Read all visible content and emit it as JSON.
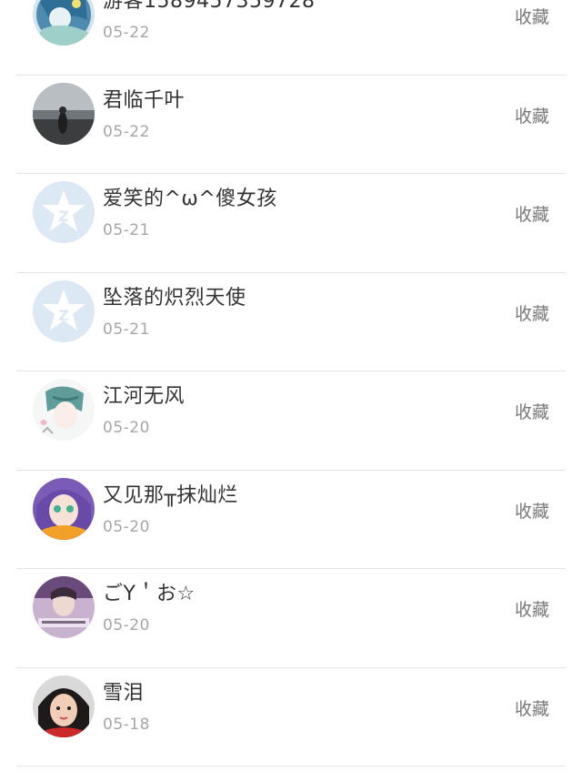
{
  "favorite_label": "收藏",
  "rows": [
    {
      "name": "游客1589457359728",
      "date": "05-22",
      "avatar": "anime-blue-avatar"
    },
    {
      "name": "君临千叶",
      "date": "05-22",
      "avatar": "photo-beach-avatar"
    },
    {
      "name": "爱笑的^ω^傻女孩",
      "date": "05-21",
      "avatar": "qzone-star-default-avatar"
    },
    {
      "name": "坠落的炽烈天使",
      "date": "05-21",
      "avatar": "qzone-star-default-avatar"
    },
    {
      "name": "江河无风",
      "date": "05-20",
      "avatar": "anime-sketch-avatar"
    },
    {
      "name": "又见那╥抹灿烂",
      "date": "05-20",
      "avatar": "anime-girl-avatar"
    },
    {
      "name": "ごY＇お☆",
      "date": "05-20",
      "avatar": "photo-girl-text-avatar"
    },
    {
      "name": "雪泪",
      "date": "05-18",
      "avatar": "photo-child-avatar"
    }
  ]
}
